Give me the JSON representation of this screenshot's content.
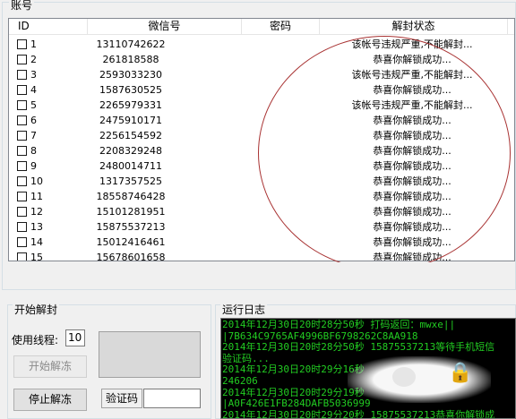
{
  "accounts_group": {
    "title": "账号",
    "columns": [
      "ID",
      "微信号",
      "密码",
      "解封状态"
    ],
    "rows": [
      {
        "id": "1",
        "wechat": "13110742622",
        "password": "",
        "status": "该帐号违规严重,不能解封..."
      },
      {
        "id": "2",
        "wechat": "261818588",
        "password": "",
        "status": "恭喜你解锁成功..."
      },
      {
        "id": "3",
        "wechat": "2593033230",
        "password": "",
        "status": "该帐号违规严重,不能解封..."
      },
      {
        "id": "4",
        "wechat": "1587630525",
        "password": "",
        "status": "恭喜你解锁成功..."
      },
      {
        "id": "5",
        "wechat": "2265979331",
        "password": "",
        "status": "该帐号违规严重,不能解封..."
      },
      {
        "id": "6",
        "wechat": "2475910171",
        "password": "",
        "status": "恭喜你解锁成功..."
      },
      {
        "id": "7",
        "wechat": "2256154592",
        "password": "",
        "status": "恭喜你解锁成功..."
      },
      {
        "id": "8",
        "wechat": "2208329248",
        "password": "",
        "status": "恭喜你解锁成功..."
      },
      {
        "id": "9",
        "wechat": "2480014711",
        "password": "",
        "status": "恭喜你解锁成功..."
      },
      {
        "id": "10",
        "wechat": "1317357525",
        "password": "",
        "status": "恭喜你解锁成功..."
      },
      {
        "id": "11",
        "wechat": "18558746428",
        "password": "",
        "status": "恭喜你解锁成功..."
      },
      {
        "id": "12",
        "wechat": "15101281951",
        "password": "",
        "status": "恭喜你解锁成功..."
      },
      {
        "id": "13",
        "wechat": "15875537213",
        "password": "",
        "status": "恭喜你解锁成功..."
      },
      {
        "id": "14",
        "wechat": "15012416461",
        "password": "",
        "status": "恭喜你解锁成功..."
      },
      {
        "id": "15",
        "wechat": "15678601658",
        "password": "",
        "status": "恭喜你解锁成功..."
      }
    ]
  },
  "unlock_group": {
    "title": "开始解封",
    "threads_label": "使用线程:",
    "threads_value": "10",
    "start_label": "开始解冻",
    "stop_label": "停止解冻",
    "captcha_label": "验证码",
    "captcha_value": ""
  },
  "log_group": {
    "title": "运行日志",
    "lines": [
      "2014年12月30日20时28分50秒  打码返回：mwxe||",
      "|7B634C9765AF4996BF6798262C8AA918",
      "2014年12月30日20时28分50秒  15875537213等待手机短信",
      "验证码...",
      "2014年12月30日20时29分16秒",
      "246206",
      "2014年12月30日20时29分19秒",
      "|A0F426E1FB284DAFB5036999",
      "2014年12月30日20时29分20秒  15875537213恭喜你解锁成"
    ]
  },
  "colors": {
    "console_bg": "#000000",
    "console_text": "#22cc22",
    "annotation_circle": "#a83232"
  }
}
